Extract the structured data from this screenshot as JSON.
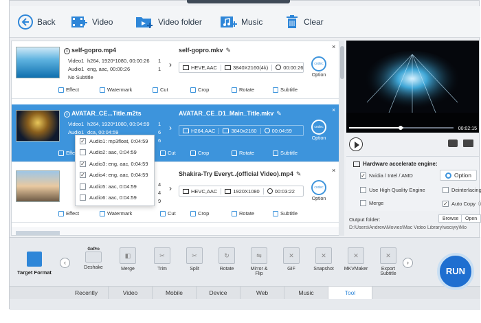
{
  "toolbar": {
    "back": "Back",
    "video": "Video",
    "video_folder": "Video folder",
    "music": "Music",
    "clear": "Clear"
  },
  "files": [
    {
      "source_name": "self-gopro.mp4",
      "video_line": "h264, 1920*1080, 00:00:26",
      "video_count": "1",
      "audio_line": "eng, aac, 00:00:26",
      "audio_count": "1",
      "subtitle_line": "No Subtitle",
      "output_name": "self-gopro.mkv",
      "codec": "HEVE,AAC",
      "resolution": "3840X2160(4k)",
      "duration": "00:00:26"
    },
    {
      "source_name": "AVATAR_CE...Title.m2ts",
      "video_line": "h264, 1920*1080, 00:04:59",
      "video_count": "1",
      "audio_line": "dca, 00:04:59",
      "audio_count": "6",
      "subtitle_count": "6",
      "output_name": "AVATAR_CE_D1_Main_Title.mkv",
      "codec": "H264,AAC",
      "resolution": "3840x2160",
      "duration": "00:04:59"
    },
    {
      "output_name": "Shakira-Try Everyt..(official Video).mp4",
      "video_count": "4",
      "audio_count": "4",
      "subtitle_count": "9",
      "codec": "HEVC,AAC",
      "resolution": "1920X1080",
      "duration": "00:03:22"
    }
  ],
  "labels": {
    "video_key": "Video1",
    "audio_key": "Audio1",
    "option": "Option",
    "close": "×"
  },
  "actions": [
    "Effect",
    "Watermark",
    "Cut",
    "Crop",
    "Rotate",
    "Subtitle"
  ],
  "audio_dropdown": [
    {
      "label": "Audio1: mp3float, 0:04:59",
      "checked": true
    },
    {
      "label": "Audio2: aac, 0:04:59",
      "checked": false
    },
    {
      "label": "Audio3: eng, aac, 0:04:59",
      "checked": true
    },
    {
      "label": "Audio4: eng, aac, 0:04:59",
      "checked": true
    },
    {
      "label": "Audio5: aac, 0:04:59",
      "checked": false
    },
    {
      "label": "Audio6: aac, 0:04:59",
      "checked": false
    }
  ],
  "preview": {
    "time": "00:02:15",
    "progress": 0.52
  },
  "hardware": {
    "title": "Hardware accelerate engine:",
    "nvidia": "Nvidia / Intel / AMD",
    "option": "Option",
    "high_quality": "Use High Quality Engine",
    "deinterlacing": "Deinterlacing",
    "merge": "Merge",
    "auto_copy": "Auto Copy"
  },
  "output": {
    "label": "Output folder:",
    "browse": "Browse",
    "open": "Open",
    "path": "D:\\Users\\Andrew\\Movies\\Mac Video Library\\wsciyiy\\Mo"
  },
  "target_format": "Target Format",
  "tools": [
    {
      "label": "Deshake",
      "badge": "GoPro"
    },
    {
      "label": "Merge"
    },
    {
      "label": "Trim"
    },
    {
      "label": "Split"
    },
    {
      "label": "Rotate"
    },
    {
      "label": "Mirror &\nFlip"
    },
    {
      "label": "GIF"
    },
    {
      "label": "Snapshot"
    },
    {
      "label": "MKVMaker"
    },
    {
      "label": "Export\nSubtitle"
    }
  ],
  "tabs": [
    "Recently",
    "Video",
    "Mobile",
    "Device",
    "Web",
    "Music",
    "Tool"
  ],
  "active_tab": "Tool",
  "run": "RUN",
  "colors": {
    "accent": "#3d94dc",
    "run": "#1f6fd0"
  }
}
